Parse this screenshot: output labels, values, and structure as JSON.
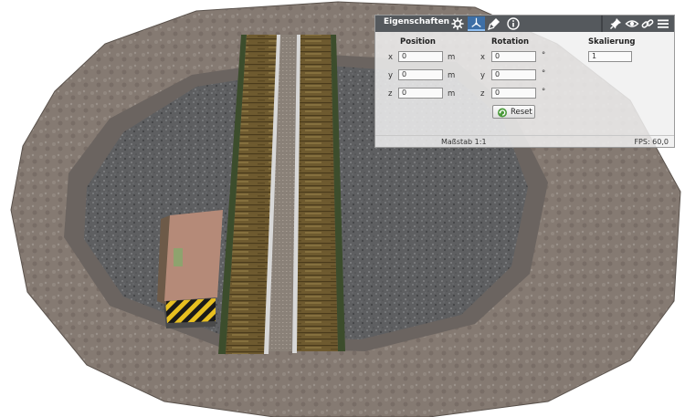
{
  "panel": {
    "title": "Eigenschaften",
    "toolbar": {
      "settings_icon": "gear-icon",
      "transform_icon": "transform-axes-icon",
      "paint_icon": "paint-icon",
      "info_icon": "info-icon",
      "pin_icon": "pin-icon",
      "visibility_icon": "eye-icon",
      "link_icon": "link-icon",
      "menu_icon": "hamburger-menu-icon"
    },
    "position": {
      "label": "Position",
      "x_label": "x",
      "y_label": "y",
      "z_label": "z",
      "x": "0",
      "y": "0",
      "z": "0",
      "unit": "m"
    },
    "rotation": {
      "label": "Rotation",
      "x_label": "x",
      "y_label": "y",
      "z_label": "z",
      "x": "0",
      "y": "0",
      "z": "0",
      "unit": "°"
    },
    "scaling": {
      "label": "Skalierung",
      "value": "1"
    },
    "reset_label": "Reset",
    "status": {
      "scale": "Maßstab 1:1",
      "fps": "FPS: 60,0"
    }
  },
  "colors": {
    "title_bar": "#55595d",
    "selected_tab": "#3d6fa6",
    "panel_bg": "#f0f0f0"
  }
}
